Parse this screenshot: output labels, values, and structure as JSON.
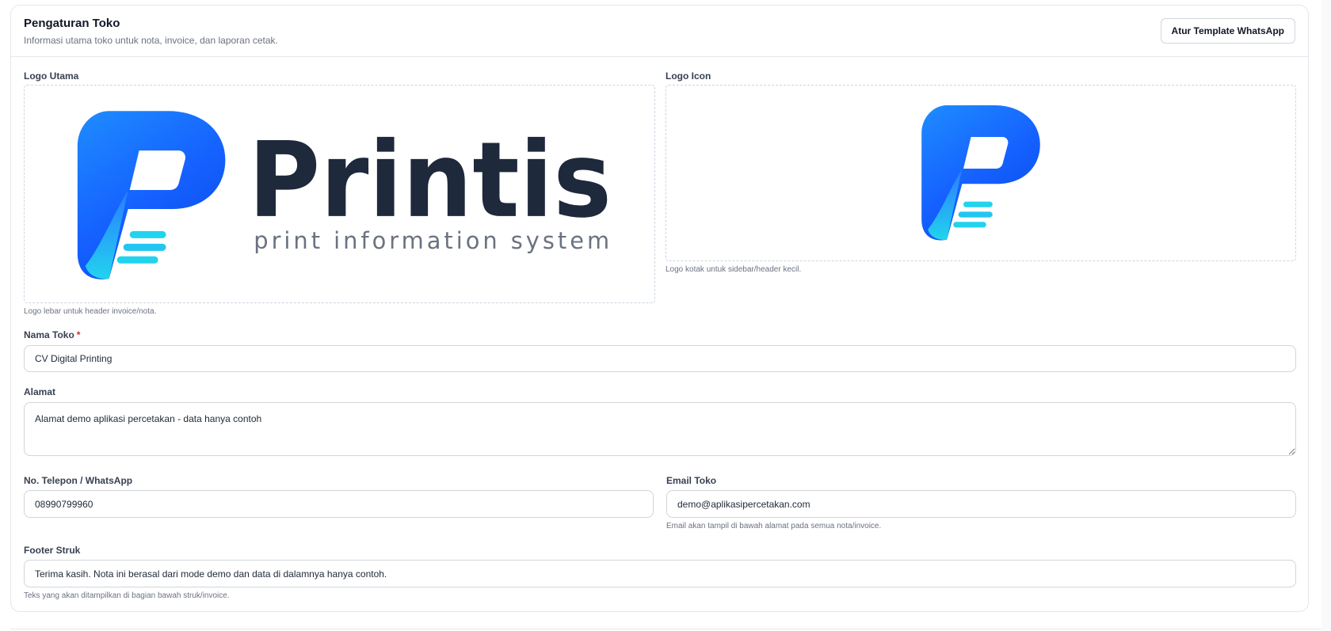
{
  "header": {
    "title": "Pengaturan Toko",
    "subtitle": "Informasi utama toko untuk nota, invoice, dan laporan cetak.",
    "whatsapp_button": "Atur Template WhatsApp"
  },
  "logo_main": {
    "label": "Logo Utama",
    "brand_name": "Printis",
    "brand_tagline": "print information system",
    "hint": "Logo lebar untuk header invoice/nota."
  },
  "logo_icon": {
    "label": "Logo Icon",
    "hint": "Logo kotak untuk sidebar/header kecil."
  },
  "store_name": {
    "label": "Nama Toko",
    "required_mark": "*",
    "value": "CV Digital Printing"
  },
  "address": {
    "label": "Alamat",
    "value": "Alamat demo aplikasi percetakan - data hanya contoh"
  },
  "phone": {
    "label": "No. Telepon / WhatsApp",
    "value": "08990799960"
  },
  "email": {
    "label": "Email Toko",
    "value": "demo@aplikasipercetakan.com",
    "hint": "Email akan tampil di bawah alamat pada semua nota/invoice."
  },
  "footer": {
    "label": "Footer Struk",
    "value": "Terima kasih. Nota ini berasal dari mode demo dan data di dalamnya hanya contoh.",
    "hint": "Teks yang akan ditampilkan di bagian bawah struk/invoice."
  },
  "colors": {
    "brand_blue": "#1f6bff",
    "brand_cyan": "#22d3ee",
    "brand_dark": "#1e293b",
    "tagline_gray": "#6b7280"
  }
}
